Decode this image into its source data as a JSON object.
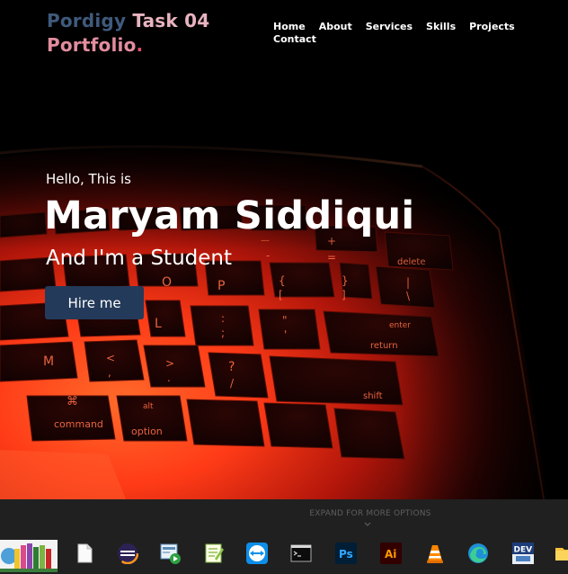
{
  "header": {
    "brand_part1": "Pordigy",
    "brand_part2": " Task 04",
    "brand_part3": "Portfolio",
    "brand_dot": ".",
    "nav": [
      "Home",
      "About",
      "Services",
      "Skills",
      "Projects",
      "Contact"
    ]
  },
  "hero": {
    "intro": "Hello, This is",
    "name": "Maryam Siddiqui",
    "role": "And I'm a Student",
    "cta_label": "Hire me"
  },
  "keyboard_keys": {
    "delete": "delete",
    "enter": "enter",
    "return": "return",
    "shift": "shift",
    "command": "command",
    "option": "option",
    "alt": "alt",
    "p": "P",
    "o": "O",
    "l": "L",
    "m": "M",
    "brace_open": "{",
    "bracket_open": "[",
    "brace_close": "}",
    "bracket_close": "]",
    "pipe": "|",
    "backslash": "\\",
    "colon": ":",
    "semicolon": ";",
    "quote": "\"",
    "apostrophe": "'",
    "lt": "<",
    "comma": ",",
    "gt": ">",
    "period": ".",
    "question": "?",
    "slash": "/",
    "cmd_symbol": "⌘",
    "plus": "+",
    "equals": "=",
    "underscore": "—",
    "minus": "-"
  },
  "taskbar": {
    "expand_label": "EXPAND FOR MORE OPTIONS",
    "icons": [
      "library-books-icon",
      "blank-document-icon",
      "eclipse-icon",
      "media-player-icon",
      "notepad-plus-plus-icon",
      "teamviewer-icon",
      "command-prompt-icon",
      "photoshop-icon",
      "illustrator-icon",
      "vlc-icon",
      "edge-icon",
      "dev-cpp-icon",
      "file-explorer-icon"
    ],
    "ps_label": "Ps",
    "ai_label": "Ai",
    "dev_label": "DEV"
  },
  "colors": {
    "brand_dark": "#3f5a7c",
    "brand_pink": "#e28d9e",
    "accent_dot": "#e2506a",
    "button_bg": "#243a5a",
    "taskbar_bg": "#202020"
  }
}
